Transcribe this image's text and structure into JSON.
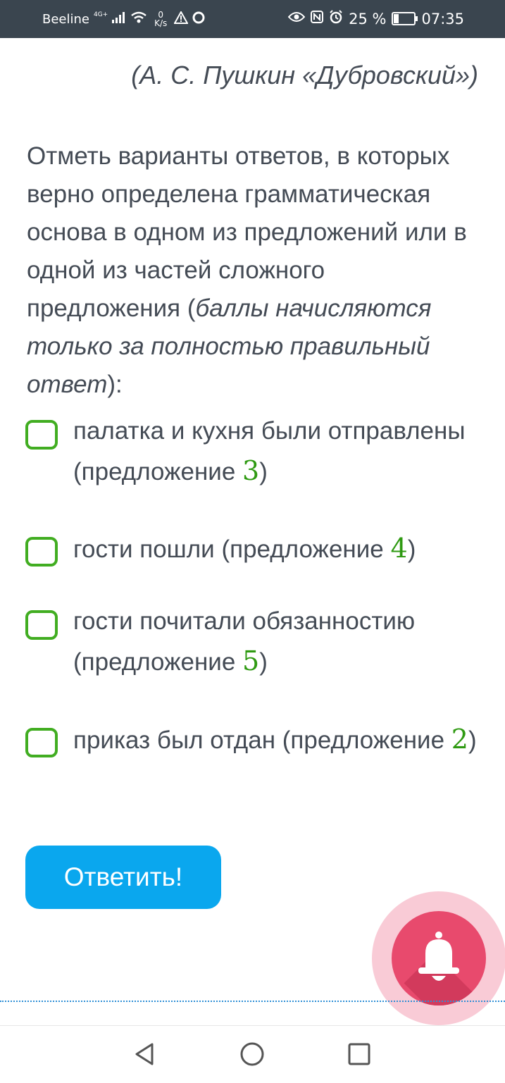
{
  "status_bar": {
    "carrier": "Beeline",
    "network": "4G+",
    "speed_value": "0",
    "speed_unit": "K/s",
    "battery_text": "25 %",
    "battery_level": 0.25,
    "time": "07:35",
    "icons": [
      "signal-icon",
      "wifi-icon",
      "warning-icon",
      "chat-icon",
      "eye-icon",
      "nfc-icon",
      "alarm-icon",
      "battery-icon"
    ]
  },
  "citation": "(А. С. Пушкин «Дубровский»)",
  "question": {
    "text_regular": "Отметь варианты ответов, в которых верно определена грамматическая основа в одном из предложений или в одной из частей сложного предложения (",
    "text_italic": "баллы начисляются только за полностью правильный ответ",
    "text_end": "):"
  },
  "options": [
    {
      "text": "палатка и кухня были отправлены (предложение ",
      "num": "3",
      "close": ")"
    },
    {
      "text": "гости пошли (предложение ",
      "num": "4",
      "close": ")"
    },
    {
      "text": "гости почитали обязанностию (предложение ",
      "num": "5",
      "close": ")"
    },
    {
      "text": "приказ был отдан (предложение ",
      "num": "2",
      "close": ")"
    }
  ],
  "submit_label": "Ответить!",
  "colors": {
    "accent_green": "#41ad21",
    "button_blue": "#0aa7ee",
    "bell_pink": "#e84a6d",
    "status_bg": "#3a454f"
  },
  "nav": [
    "back-icon",
    "home-icon",
    "recents-icon"
  ]
}
